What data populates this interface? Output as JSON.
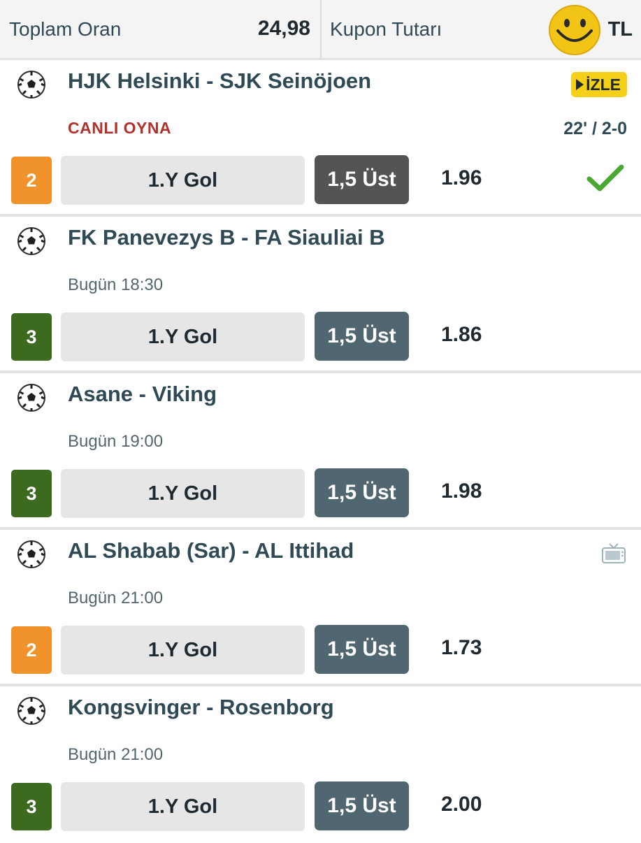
{
  "header": {
    "total_odds_label": "Toplam Oran",
    "total_odds_value": "24,98",
    "coupon_amount_label": "Kupon Tutarı",
    "currency": "TL"
  },
  "matches": [
    {
      "teams": "HJK Helsinki - SJK Seinöjoen",
      "status": "CANLI OYNA",
      "live": true,
      "score": "22' / 2-0",
      "watch_label": "İZLE",
      "rank": "2",
      "rank_color": "#f0932b",
      "market": "1.Y Gol",
      "pick": "1,5 Üst",
      "odd": "1.96",
      "won": true
    },
    {
      "teams": "FK Panevezys B - FA Siauliai B",
      "status": "Bugün 18:30",
      "rank": "3",
      "rank_color": "#3c6a1e",
      "market": "1.Y Gol",
      "pick": "1,5 Üst",
      "odd": "1.86"
    },
    {
      "teams": "Asane - Viking",
      "status": "Bugün 19:00",
      "rank": "3",
      "rank_color": "#3c6a1e",
      "market": "1.Y Gol",
      "pick": "1,5 Üst",
      "odd": "1.98"
    },
    {
      "teams": "AL Shabab (Sar) - AL Ittihad",
      "status": "Bugün 21:00",
      "tv": true,
      "rank": "2",
      "rank_color": "#f0932b",
      "market": "1.Y Gol",
      "pick": "1,5 Üst",
      "odd": "1.73"
    },
    {
      "teams": "Kongsvinger - Rosenborg",
      "status": "Bugün 21:00",
      "rank": "3",
      "rank_color": "#3c6a1e",
      "market": "1.Y Gol",
      "pick": "1,5 Üst",
      "odd": "2.00"
    }
  ]
}
